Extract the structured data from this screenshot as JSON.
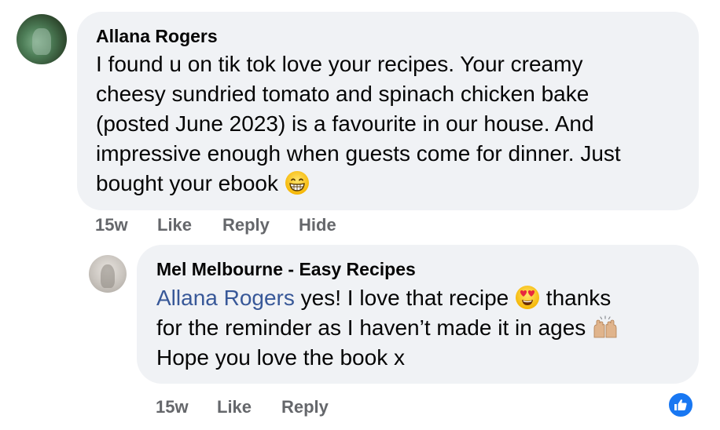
{
  "comment": {
    "author": "Allana Rogers",
    "text_lines": [
      "I found u on tik tok love your recipes. Your creamy",
      "cheesy sundried tomato and spinach chicken bake",
      "(posted June 2023) is a favourite in our house. And",
      "impressive enough when guests come for dinner. Just",
      "bought your ebook"
    ],
    "emoji": "grinning-face-icon",
    "time": "15w",
    "like_label": "Like",
    "reply_label": "Reply",
    "hide_label": "Hide"
  },
  "reply": {
    "author": "Mel Melbourne - Easy Recipes",
    "mention": "Allana Rogers",
    "line1_after_mention": " yes! I love that recipe ",
    "line1_end": " thanks",
    "line2": "for the reminder as I haven’t made it in ages ",
    "line3": "Hope you love the book x",
    "emojis": [
      "heart-eyes-icon",
      "raised-hands-icon"
    ],
    "time": "15w",
    "like_label": "Like",
    "reply_label": "Reply"
  },
  "reaction": {
    "icon": "thumbs-up-icon",
    "color": "#1877f2"
  }
}
